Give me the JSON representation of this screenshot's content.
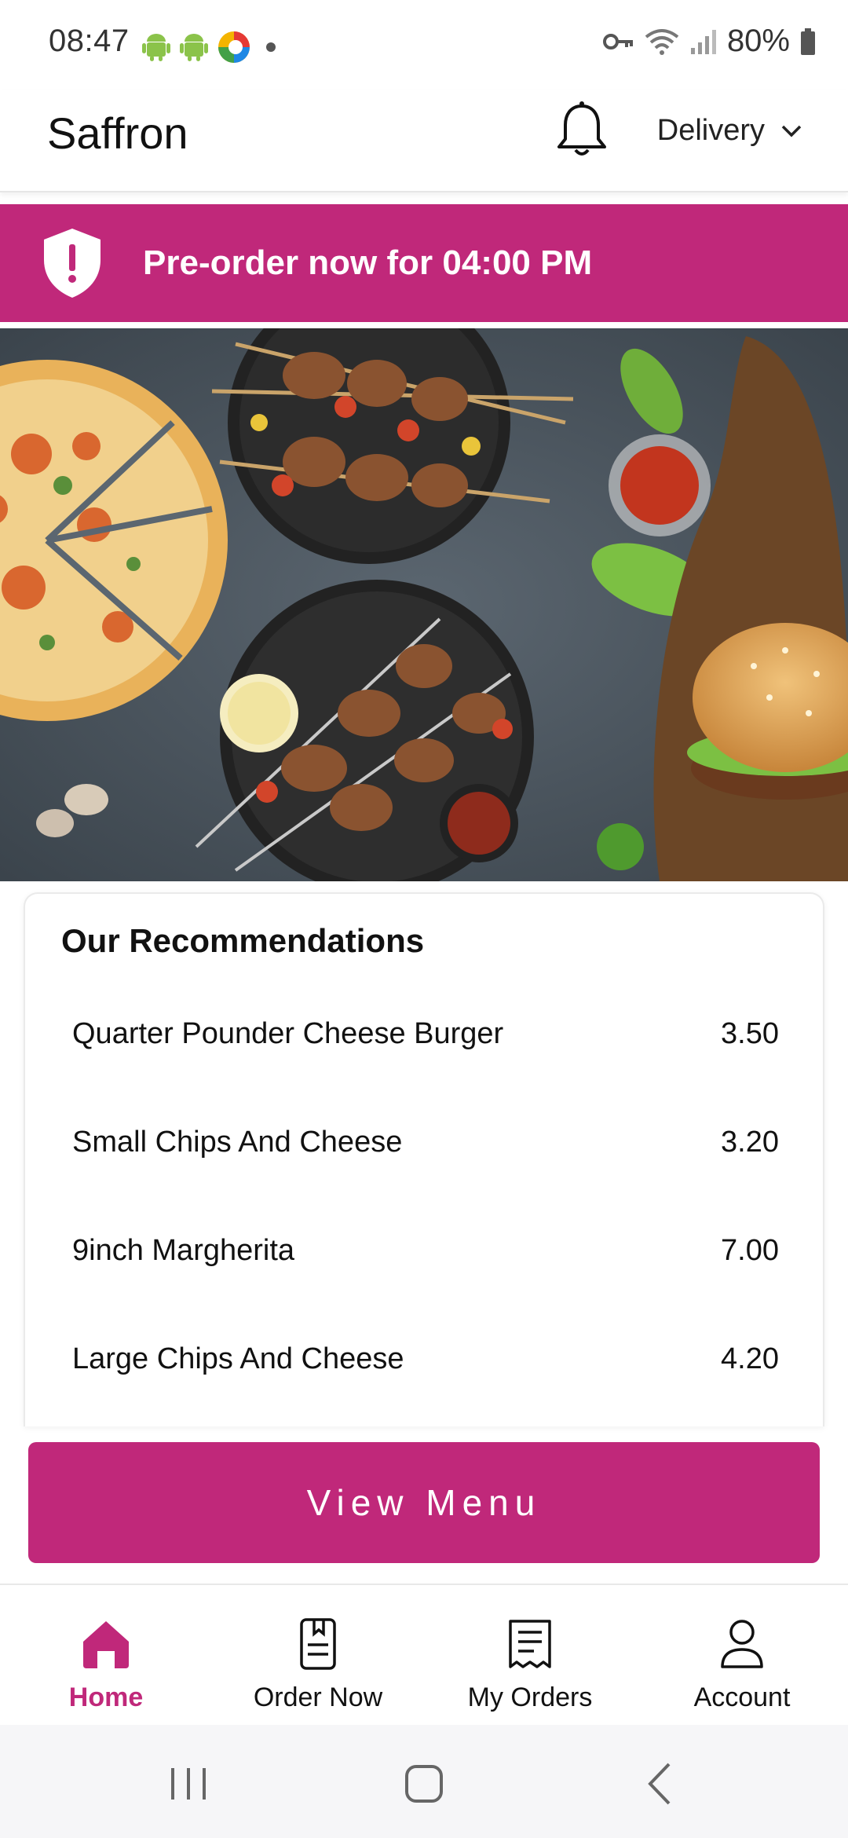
{
  "status_bar": {
    "time": "08:47",
    "battery": "80%",
    "left_icons": [
      "android-icon",
      "android-icon",
      "app-colorwheel-icon",
      "dot-icon"
    ],
    "right_icons": [
      "key-icon",
      "wifi-icon",
      "signal-icon",
      "battery-icon"
    ]
  },
  "header": {
    "title": "Saffron",
    "bell_icon": "bell-icon",
    "delivery_label": "Delivery"
  },
  "banner": {
    "text": "Pre-order now for 04:00 PM",
    "color": "#c0287a"
  },
  "recommendations": {
    "title": "Our Recommendations",
    "items": [
      {
        "name": "Quarter Pounder Cheese Burger",
        "price": "3.50"
      },
      {
        "name": "Small Chips And Cheese",
        "price": "3.20"
      },
      {
        "name": "9inch Margherita",
        "price": "7.00"
      },
      {
        "name": "Large Chips And Cheese",
        "price": "4.20"
      }
    ]
  },
  "view_menu_label": "View Menu",
  "bottom_nav": {
    "items": [
      {
        "label": "Home",
        "icon": "home-icon",
        "active": true
      },
      {
        "label": "Order Now",
        "icon": "order-book-icon",
        "active": false
      },
      {
        "label": "My Orders",
        "icon": "receipt-icon",
        "active": false
      },
      {
        "label": "Account",
        "icon": "user-icon",
        "active": false
      }
    ]
  },
  "colors": {
    "accent": "#c0287a",
    "text": "#111111"
  }
}
